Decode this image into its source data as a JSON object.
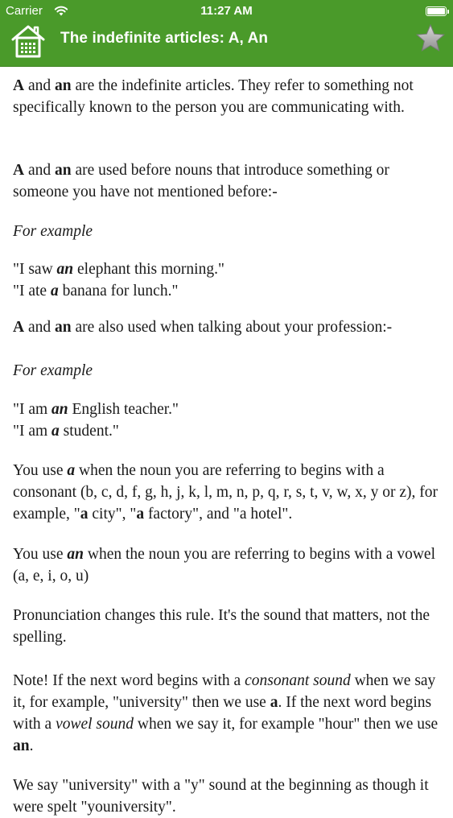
{
  "status_bar": {
    "carrier": "Carrier",
    "time": "11:27 AM"
  },
  "nav": {
    "title": "The indefinite articles: A, An",
    "home_icon": "home-icon",
    "star_icon": "star-icon",
    "bar_color": "#4a9a2a"
  },
  "content": {
    "p1": {
      "a": "A",
      "and": " and ",
      "an": "an",
      "rest": " are the indefinite articles. They refer to something not specifically known to the person you are communicating with."
    },
    "p2": {
      "a": "A",
      "and": " and ",
      "an": "an",
      "rest": " are used before nouns that introduce something or someone you have not mentioned before:-"
    },
    "example_label_1": "For example",
    "ex1": {
      "l1_pre": "\"I saw ",
      "l1_em": "an",
      "l1_post": " elephant this morning.\"",
      "l2_pre": "\"I ate ",
      "l2_em": "a",
      "l2_post": " banana for lunch.\""
    },
    "p3": {
      "a": "A",
      "and": " and ",
      "an": "an",
      "rest": " are also used when talking about your profession:-"
    },
    "example_label_2": "For example",
    "ex2": {
      "l1_pre": "\"I am ",
      "l1_em": "an",
      "l1_post": " English teacher.\"",
      "l2_pre": "\"I am ",
      "l2_em": "a",
      "l2_post": " student.\""
    },
    "p4": {
      "pre": "You use ",
      "em": "a",
      "mid": " when the noun you are referring to begins with a consonant (b, c, d, f, g, h, j, k, l, m, n, p, q, r, s, t, v, w, x, y or z), for example, \"",
      "b1": "a",
      "mid2": " city\", \"",
      "b2": "a",
      "post": " factory\", and \"a hotel\"."
    },
    "p5": {
      "pre": "You use ",
      "em": "an",
      "post": " when the noun you are referring to begins with a vowel (a, e, i, o, u)"
    },
    "p6": "Pronunciation changes this rule. It's the sound that matters, not the spelling.",
    "p7": {
      "s1": "Note! If the next word begins with a ",
      "i1": "consonant sound",
      "s2": " when we say it, for example, \"university\" then we use ",
      "b1": "a",
      "s3": ". If the next word begins with a ",
      "i2": "vowel sound",
      "s4": " when we say it, for example \"hour\" then we use ",
      "b2": "an",
      "s5": "."
    },
    "p8": "We say \"university\" with a \"y\" sound at the beginning as though it were spelt \"youniversity\"."
  }
}
